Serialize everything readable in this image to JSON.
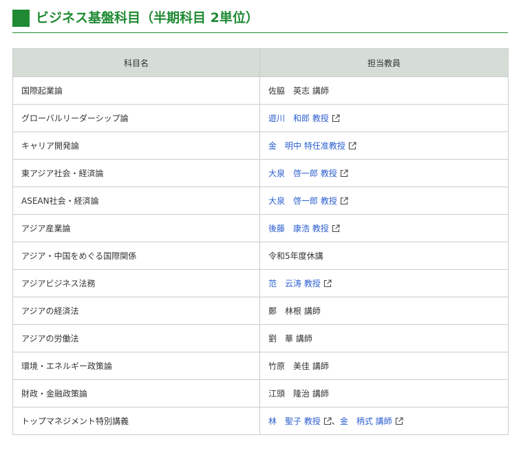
{
  "heading": {
    "title": "ビジネス基盤科目（半期科目 2単位）"
  },
  "table": {
    "headers": [
      "科目名",
      "担当教員"
    ],
    "rows": [
      {
        "course": "国際起業論",
        "teachers": [
          {
            "name": "佐脇　英志 講師",
            "link": false
          }
        ]
      },
      {
        "course": "グローバルリーダーシップ論",
        "teachers": [
          {
            "name": "遊川　和郎 教授",
            "link": true
          }
        ]
      },
      {
        "course": "キャリア開発論",
        "teachers": [
          {
            "name": "金　明中 特任准教授",
            "link": true
          }
        ]
      },
      {
        "course": "東アジア社会・経済論",
        "teachers": [
          {
            "name": "大泉　啓一郎 教授",
            "link": true
          }
        ]
      },
      {
        "course": "ASEAN社会・経済論",
        "teachers": [
          {
            "name": "大泉　啓一郎 教授",
            "link": true
          }
        ]
      },
      {
        "course": "アジア産業論",
        "teachers": [
          {
            "name": "後藤　康浩 教授",
            "link": true
          }
        ]
      },
      {
        "course": "アジア・中国をめぐる国際関係",
        "teachers": [
          {
            "name": "令和5年度休講",
            "link": false
          }
        ]
      },
      {
        "course": "アジアビジネス法務",
        "teachers": [
          {
            "name": "范　云涛 教授",
            "link": true
          }
        ]
      },
      {
        "course": "アジアの経済法",
        "teachers": [
          {
            "name": "鄭　林根 講師",
            "link": false
          }
        ]
      },
      {
        "course": "アジアの労働法",
        "teachers": [
          {
            "name": "劉　華 講師",
            "link": false
          }
        ]
      },
      {
        "course": "環境・エネルギー政策論",
        "teachers": [
          {
            "name": "竹原　美佳 講師",
            "link": false
          }
        ]
      },
      {
        "course": "財政・金融政策論",
        "teachers": [
          {
            "name": "江頭　隆治 講師",
            "link": false
          }
        ]
      },
      {
        "course": "トップマネジメント特別講義",
        "teachers": [
          {
            "name": "林　聖子 教授",
            "link": true
          },
          {
            "name": "金　柄式 講師",
            "link": true
          }
        ]
      }
    ],
    "separator": "、"
  },
  "icons": {
    "external": "external-link-icon"
  },
  "colors": {
    "brand": "#1f8a33",
    "link": "#2b5fcf",
    "header_bg": "#d5ddd6",
    "border": "#cccccc"
  }
}
